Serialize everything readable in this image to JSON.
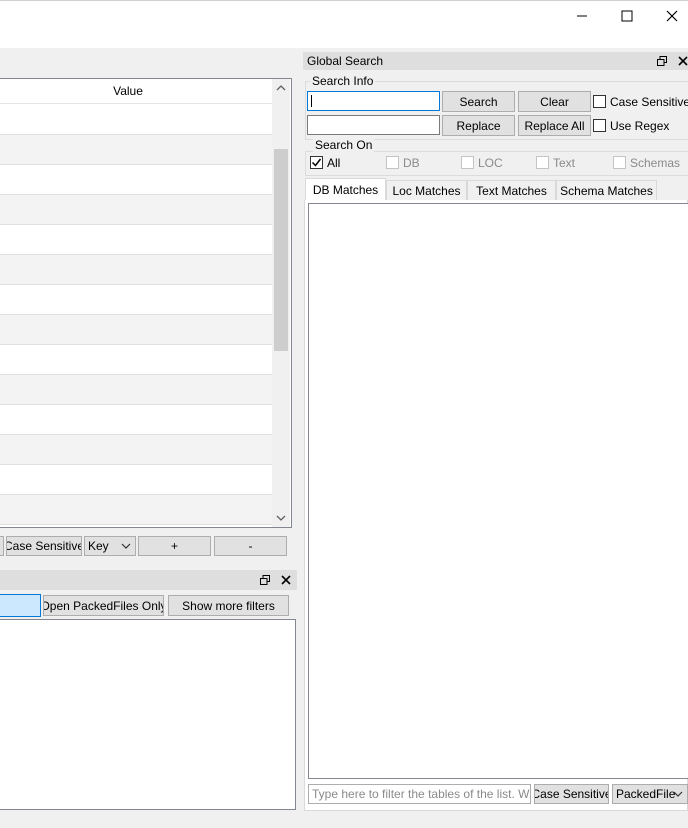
{
  "window": {
    "minimize_glyph": "—",
    "maximize_glyph": "☐",
    "close_glyph": "✕"
  },
  "table": {
    "header": "Value",
    "row_count": 14
  },
  "table_toolbar": {
    "case_sensitive": "Case Sensitive",
    "column_select": "Key",
    "add": "+",
    "remove": "-"
  },
  "lower_panel": {
    "open_packed_only": "Open PackedFiles Only",
    "show_more_filters": "Show more filters"
  },
  "global_search": {
    "title": "Global Search",
    "search_info_label": "Search Info",
    "search_button": "Search",
    "clear_button": "Clear",
    "case_sensitive_label": "Case Sensitive",
    "replace_button": "Replace",
    "replace_all_button": "Replace All",
    "use_regex_label": "Use Regex",
    "search_on_label": "Search On",
    "options": {
      "all": "All",
      "db": "DB",
      "loc": "LOC",
      "text": "Text",
      "schemas": "Schemas"
    },
    "tabs": [
      "DB Matches",
      "Loc Matches",
      "Text Matches",
      "Schema Matches"
    ],
    "filter_placeholder": "Type here to filter the tables of the list. W...",
    "filter_case_sensitive": "Case Sensitive",
    "filter_column": "PackedFile"
  }
}
